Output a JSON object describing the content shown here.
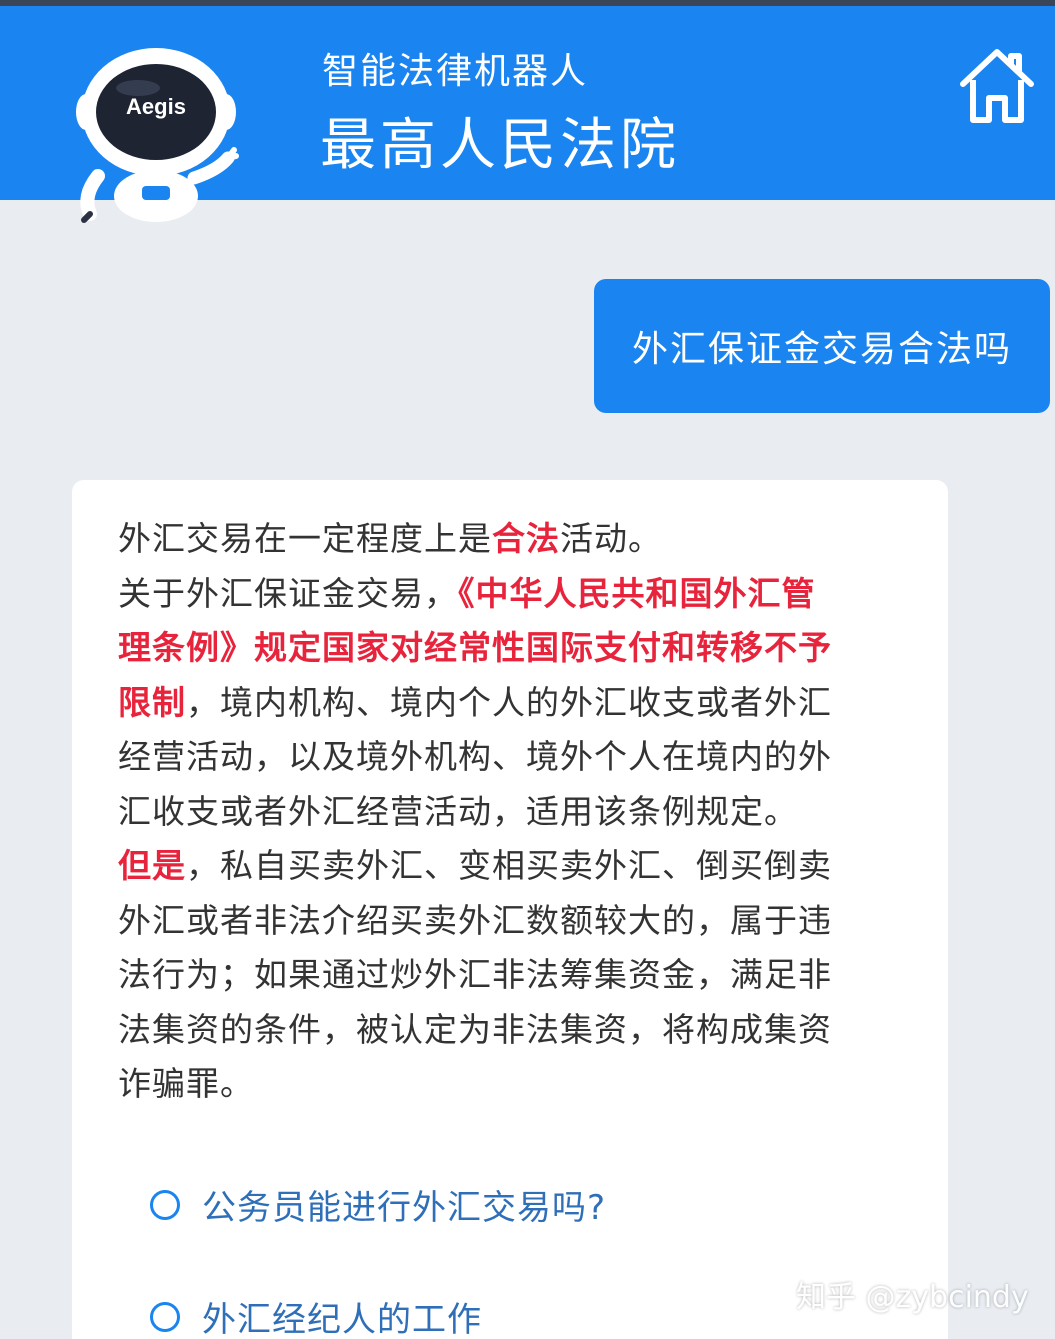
{
  "header": {
    "subtitle": "智能法律机器人",
    "title": "最高人民法院",
    "robot_badge": "Aegis",
    "home_icon": "home-icon"
  },
  "chat": {
    "user_question": "外汇保证金交易合法吗",
    "answer_lines": [
      [
        {
          "t": "外汇交易在一定程度上是"
        },
        {
          "t": "合法",
          "hl": true
        },
        {
          "t": "活动。"
        }
      ],
      [
        {
          "t": "关于外汇保证金交易，"
        },
        {
          "t": "《中华人民共和国外汇管",
          "hl": true
        }
      ],
      [
        {
          "t": "理条例》规定国家对经常性国际支付和转移不予",
          "hl": true
        }
      ],
      [
        {
          "t": "限制",
          "hl": true
        },
        {
          "t": "，境内机构、境内个人的外汇收支或者外汇"
        }
      ],
      [
        {
          "t": "经营活动，以及境外机构、境外个人在境内的外"
        }
      ],
      [
        {
          "t": "汇收支或者外汇经营活动，适用该条例规定。"
        }
      ],
      [
        {
          "t": "但是",
          "hl": true
        },
        {
          "t": "，私自买卖外汇、变相买卖外汇、倒买倒卖"
        }
      ],
      [
        {
          "t": "外汇或者非法介绍买卖外汇数额较大的，属于违"
        }
      ],
      [
        {
          "t": "法行为；如果通过炒外汇非法筹集资金，满足非"
        }
      ],
      [
        {
          "t": "法集资的条件，被认定为非法集资，将构成集资"
        }
      ],
      [
        {
          "t": "诈骗罪。"
        }
      ]
    ],
    "suggestions": [
      "公务员能进行外汇交易吗?",
      "外汇经纪人的工作"
    ]
  },
  "watermark": "知乎 @zybcindy",
  "colors": {
    "header_blue": "#1a84f0",
    "highlight_red": "#e8243c",
    "background": "#e9edf2"
  }
}
